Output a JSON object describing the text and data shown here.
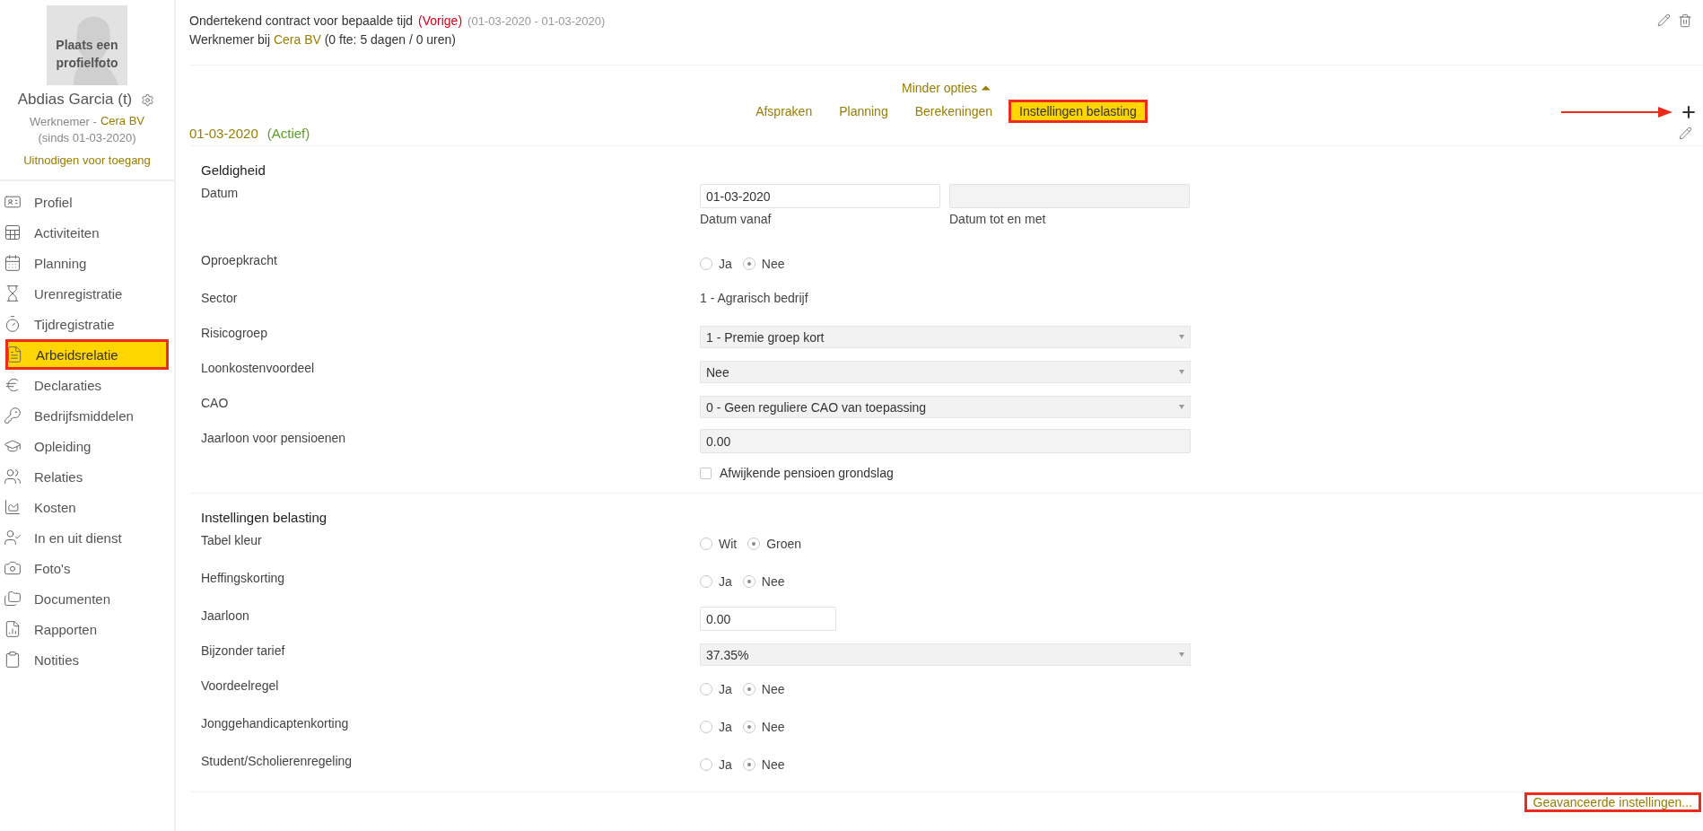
{
  "profile": {
    "photo_caption": "Plaats een profielfoto",
    "name": "Abdias Garcia (t)",
    "role": "Werknemer -",
    "employer": "Cera BV",
    "since": "(sinds 01-03-2020)",
    "invite_link": "Uitnodigen voor toegang"
  },
  "sidebar": {
    "items": [
      {
        "kind": "profile",
        "label": "Profiel",
        "selected": false
      },
      {
        "kind": "activities",
        "label": "Activiteiten",
        "selected": false
      },
      {
        "kind": "planning",
        "label": "Planning",
        "selected": false
      },
      {
        "kind": "hours",
        "label": "Urenregistratie",
        "selected": false
      },
      {
        "kind": "time",
        "label": "Tijdregistratie",
        "selected": false
      },
      {
        "kind": "contract",
        "label": "Arbeidsrelatie",
        "selected": true,
        "annotated": true
      },
      {
        "kind": "expenses",
        "label": "Declaraties",
        "selected": false
      },
      {
        "kind": "assets",
        "label": "Bedrijfsmiddelen",
        "selected": false
      },
      {
        "kind": "training",
        "label": "Opleiding",
        "selected": false
      },
      {
        "kind": "relations",
        "label": "Relaties",
        "selected": false
      },
      {
        "kind": "costs",
        "label": "Kosten",
        "selected": false
      },
      {
        "kind": "employment",
        "label": "In en uit dienst",
        "selected": false
      },
      {
        "kind": "photos",
        "label": "Foto's",
        "selected": false
      },
      {
        "kind": "documents",
        "label": "Documenten",
        "selected": false
      },
      {
        "kind": "reports",
        "label": "Rapporten",
        "selected": false
      },
      {
        "kind": "notes",
        "label": "Notities",
        "selected": false
      }
    ]
  },
  "header": {
    "title": "Ondertekend contract voor bepaalde tijd",
    "status": "(Vorige)",
    "period": "(01-03-2020 - 01-03-2020)",
    "line2_prefix": "Werknemer bij",
    "line2_employer": "Cera BV",
    "line2_suffix": "(0 fte: 5 dagen / 0 uren)"
  },
  "options": {
    "toggle": "Minder opties",
    "toggle_icon": "⏶",
    "tabs": [
      {
        "label": "Afspraken",
        "selected": false
      },
      {
        "label": "Planning",
        "selected": false
      },
      {
        "label": "Berekeningen",
        "selected": false
      },
      {
        "label": "Instellingen belasting",
        "selected": true,
        "annotated": true
      }
    ],
    "add_button": {
      "annotated": true
    }
  },
  "period": {
    "date": "01-03-2020",
    "status": "(Actief)"
  },
  "sections": [
    {
      "title": "Geldigheid",
      "rows": [
        {
          "kind": "date-range",
          "label": "Datum",
          "from": {
            "value": "01-03-2020",
            "caption": "Datum vanaf",
            "disabled": false
          },
          "to": {
            "caption": "Datum tot en met",
            "disabled": true
          }
        },
        {
          "kind": "radio",
          "label": "Oproepkracht",
          "options": [
            {
              "label": "Ja",
              "selected": false
            },
            {
              "label": "Nee",
              "selected": true
            }
          ]
        },
        {
          "kind": "text",
          "label": "Sector",
          "value": "1 - Agrarisch bedrijf"
        },
        {
          "kind": "select",
          "label": "Risicogroep",
          "value": "1 - Premie groep kort"
        },
        {
          "kind": "select",
          "label": "Loonkostenvoordeel",
          "value": "Nee"
        },
        {
          "kind": "select",
          "label": "CAO",
          "value": "0 - Geen reguliere CAO van toepassing"
        },
        {
          "kind": "input",
          "label": "Jaarloon voor pensioenen",
          "value": "0.00",
          "disabled": true
        },
        {
          "kind": "checkbox",
          "text": "Afwijkende pensioen grondslag",
          "checked": false
        }
      ]
    },
    {
      "title": "Instellingen belasting",
      "rows": [
        {
          "kind": "radio",
          "label": "Tabel kleur",
          "options": [
            {
              "label": "Wit",
              "selected": false
            },
            {
              "label": "Groen",
              "selected": true
            }
          ]
        },
        {
          "kind": "radio",
          "label": "Heffingskorting",
          "options": [
            {
              "label": "Ja",
              "selected": false
            },
            {
              "label": "Nee",
              "selected": true
            }
          ]
        },
        {
          "kind": "short-input",
          "label": "Jaarloon",
          "value": "0.00",
          "disabled": false
        },
        {
          "kind": "select",
          "label": "Bijzonder tarief",
          "value": "37.35%"
        },
        {
          "kind": "radio",
          "label": "Voordeelregel",
          "options": [
            {
              "label": "Ja",
              "selected": false
            },
            {
              "label": "Nee",
              "selected": true
            }
          ]
        },
        {
          "kind": "radio",
          "label": "Jonggehandicaptenkorting",
          "options": [
            {
              "label": "Ja",
              "selected": false
            },
            {
              "label": "Nee",
              "selected": true
            }
          ]
        },
        {
          "kind": "radio",
          "label": "Student/Scholierenregeling",
          "options": [
            {
              "label": "Ja",
              "selected": false
            },
            {
              "label": "Nee",
              "selected": true
            }
          ]
        }
      ]
    }
  ],
  "footer": {
    "link": "Geavanceerde instellingen...",
    "annotated": true
  }
}
